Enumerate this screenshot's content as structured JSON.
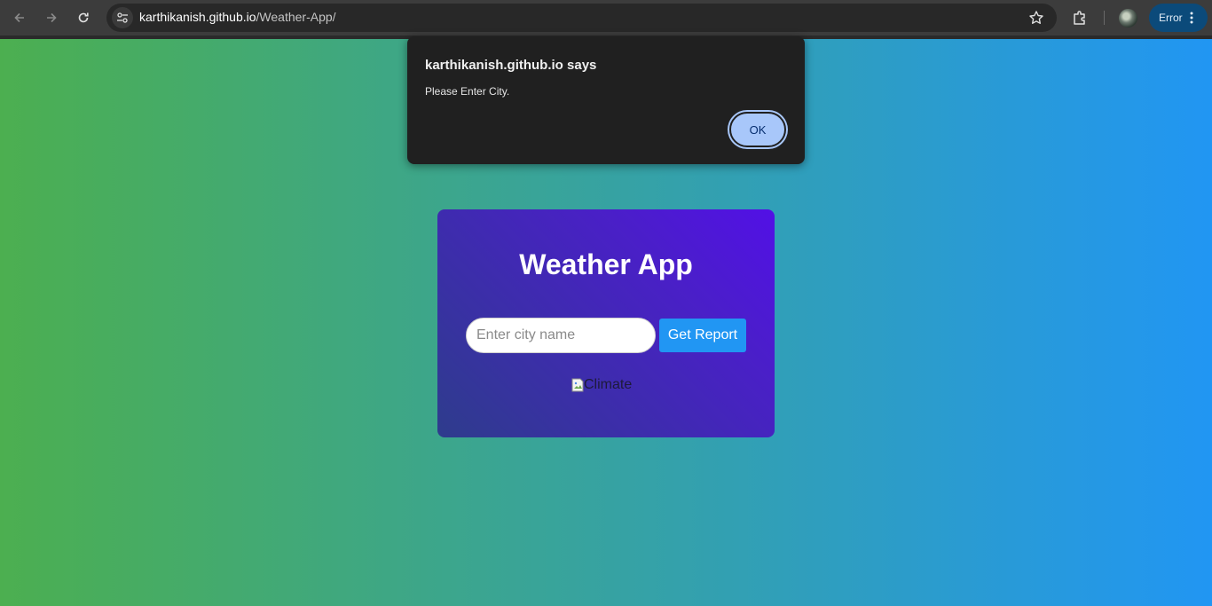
{
  "browser": {
    "url_host": "karthikanish.github.io",
    "url_path": "/Weather-App/",
    "error_chip_label": "Error"
  },
  "icons": {
    "back": "back-arrow-icon",
    "forward": "forward-arrow-icon",
    "reload": "reload-icon",
    "site_info": "tune-icon",
    "bookmark": "star-icon",
    "extensions": "puzzle-icon",
    "menu": "kebab-menu-icon"
  },
  "colors": {
    "page_gradient_start": "#4caf50",
    "page_gradient_end": "#2196f3",
    "card_gradient_start": "#2e3c8c",
    "card_gradient_end": "#5210e6",
    "report_button": "#2196f3",
    "dialog_background": "#202020",
    "ok_button": "#a8c7fa"
  },
  "app": {
    "title": "Weather App",
    "city_input": {
      "placeholder": "Enter city name",
      "value": ""
    },
    "report_button_label": "Get Report",
    "climate_image_alt": "Climate"
  },
  "alert": {
    "title": "karthikanish.github.io says",
    "message": "Please Enter City.",
    "ok_label": "OK"
  }
}
